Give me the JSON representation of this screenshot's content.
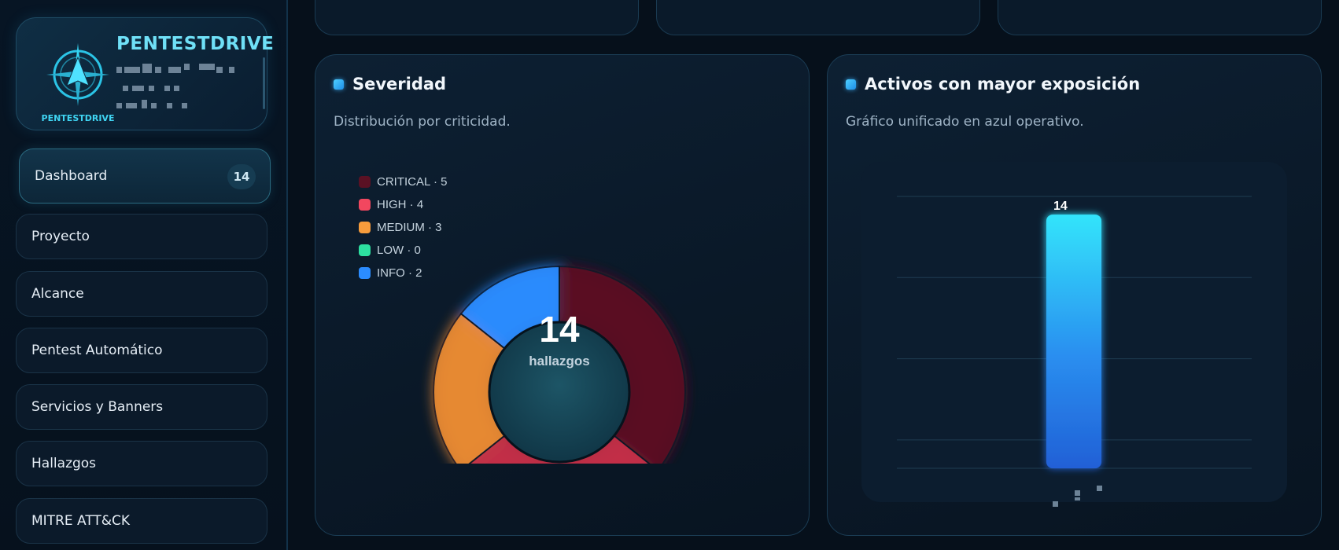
{
  "brand": {
    "title": "PENTESTDRIVE",
    "logo_text": "PENTESTDRIVE"
  },
  "nav": {
    "active": {
      "label": "Dashboard",
      "badge": "14"
    },
    "items": [
      {
        "label": "Proyecto"
      },
      {
        "label": "Alcance"
      },
      {
        "label": "Pentest Automático"
      },
      {
        "label": "Servicios y Banners"
      },
      {
        "label": "Hallazgos"
      },
      {
        "label": "MITRE ATT&CK"
      }
    ]
  },
  "severity_panel": {
    "title": "Severidad",
    "subtitle": "Distribución por criticidad.",
    "center_value": "14",
    "center_label": "hallazgos",
    "legend": [
      {
        "label": "CRITICAL · 5",
        "color": "#5a1124"
      },
      {
        "label": "HIGH · 4",
        "color": "#f2475f"
      },
      {
        "label": "MEDIUM · 3",
        "color": "#f79c3c"
      },
      {
        "label": "LOW · 0",
        "color": "#2de0a0"
      },
      {
        "label": "INFO · 2",
        "color": "#2b8cff"
      }
    ]
  },
  "exposure_panel": {
    "title": "Activos con mayor exposición",
    "subtitle": "Gráfico unificado en azul operativo."
  },
  "colors": {
    "accent": "#3ad0ff",
    "panel_border": "#1b3d55"
  },
  "chart_data": [
    {
      "type": "pie",
      "categories": [
        "CRITICAL",
        "HIGH",
        "MEDIUM",
        "LOW",
        "INFO"
      ],
      "values": [
        5,
        4,
        3,
        0,
        2
      ],
      "colors": [
        "#5a1124",
        "#c43048",
        "#e88a33",
        "#2de0a0",
        "#2b8cff"
      ],
      "total": 14,
      "legend": "top-left"
    },
    {
      "type": "bar",
      "categories": [
        ""
      ],
      "values": [
        14
      ],
      "ylim": [
        0,
        15
      ],
      "grid": true
    }
  ]
}
